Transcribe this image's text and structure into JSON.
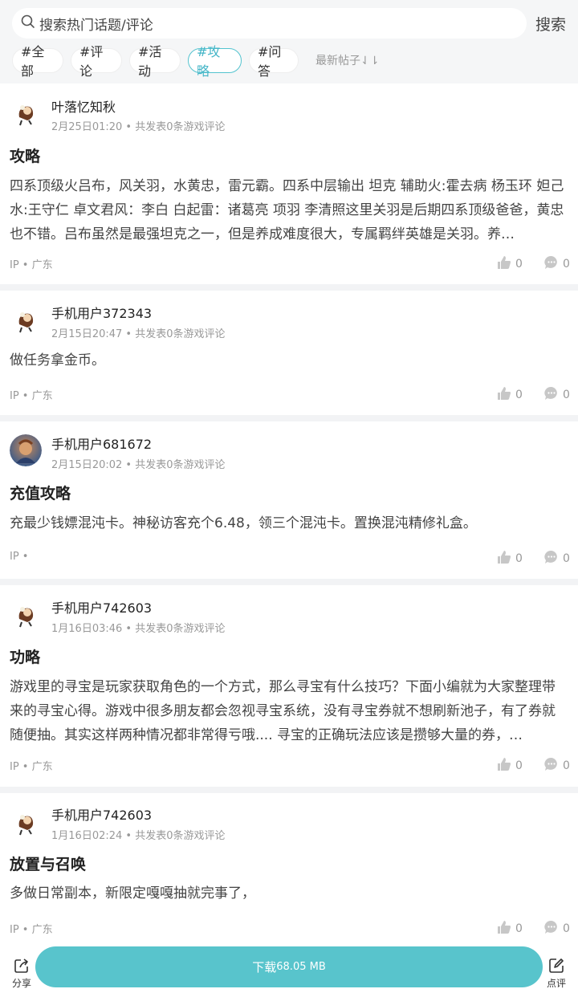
{
  "search": {
    "placeholder": "搜索热门话题/评论",
    "button": "搜索"
  },
  "tags": [
    "#全部",
    "#评论",
    "#活动",
    "#攻略",
    "#问答"
  ],
  "active_tag": "#攻略",
  "sort_label": "最新帖子⇃⇂",
  "posts": [
    {
      "user": "叶落忆知秋",
      "time": "2月25日01:20",
      "count_text": "共发表0条游戏评论",
      "title": "攻略",
      "content": "四系顶级火吕布，风关羽，水黄忠，雷元霸。四系中层输出 坦克 辅助火:霍去病 杨玉环 妲己水:王守仁 卓文君风：李白 白起雷：诸葛亮 项羽 李清照这里关羽是后期四系顶级爸爸，黄忠也不错。吕布虽然是最强坦克之一，但是养成难度很大，专属羁绊英雄是关羽。养…",
      "ip": "IP • 广东",
      "likes": "0",
      "comments": "0"
    },
    {
      "user": "手机用户372343",
      "time": "2月15日20:47",
      "count_text": "共发表0条游戏评论",
      "title": "",
      "content": "做任务拿金币。",
      "ip": "IP • 广东",
      "likes": "0",
      "comments": "0"
    },
    {
      "user": "手机用户681672",
      "time": "2月15日20:02",
      "count_text": "共发表0条游戏评论",
      "title": "充值攻略",
      "content": "充最少钱嫖混沌卡。神秘访客充个6.48，领三个混沌卡。置换混沌精修礼盒。",
      "ip": "IP •",
      "likes": "0",
      "comments": "0"
    },
    {
      "user": "手机用户742603",
      "time": "1月16日03:46",
      "count_text": "共发表0条游戏评论",
      "title": "功略",
      "content": "游戏里的寻宝是玩家获取角色的一个方式，那么寻宝有什么技巧？下面小编就为大家整理带来的寻宝心得。游戏中很多朋友都会忽视寻宝系统，没有寻宝券就不想刷新池子，有了券就随便抽。其实这样两种情况都非常得亏哦.... 寻宝的正确玩法应该是攒够大量的券，…",
      "ip": "IP • 广东",
      "likes": "0",
      "comments": "0"
    },
    {
      "user": "手机用户742603",
      "time": "1月16日02:24",
      "count_text": "共发表0条游戏评论",
      "title": "放置与召唤",
      "content": "多做日常副本，新限定嘎嘎抽就完事了，",
      "ip": "IP • 广东",
      "likes": "0",
      "comments": "0"
    }
  ],
  "bottom": {
    "share": "分享",
    "download": "下载",
    "download_size": "68.05 MB",
    "review": "点评"
  },
  "colors": {
    "accent": "#58c4cc",
    "active_tag_text": "#44b5c7"
  }
}
